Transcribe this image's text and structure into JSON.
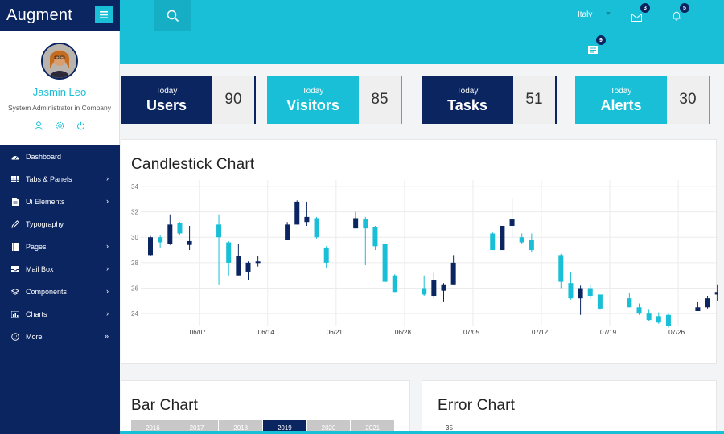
{
  "brand": {
    "title": "Augment"
  },
  "profile": {
    "name": "Jasmin Leo",
    "role": "System Administrator in Company"
  },
  "nav": {
    "items": [
      {
        "label": "Dashboard",
        "icon": "dashboard-icon",
        "has_arrow": false
      },
      {
        "label": "Tabs & Panels",
        "icon": "table-icon",
        "has_arrow": true
      },
      {
        "label": "Ui Elements",
        "icon": "file-icon",
        "has_arrow": true
      },
      {
        "label": "Typography",
        "icon": "pencil-icon",
        "has_arrow": false
      },
      {
        "label": "Pages",
        "icon": "book-icon",
        "has_arrow": true
      },
      {
        "label": "Mail Box",
        "icon": "inbox-icon",
        "has_arrow": true
      },
      {
        "label": "Components",
        "icon": "layers-icon",
        "has_arrow": true
      },
      {
        "label": "Charts",
        "icon": "chart-icon",
        "has_arrow": true
      },
      {
        "label": "More",
        "icon": "smile-icon",
        "has_arrow": true
      }
    ],
    "arrow": "›",
    "more_arrow": "»"
  },
  "topbar": {
    "language": "Italy",
    "mail_count": "3",
    "bell_count": "5",
    "messages_count": "9"
  },
  "stats": [
    {
      "small": "Today",
      "label": "Users",
      "value": "90",
      "theme": "navy"
    },
    {
      "small": "Today",
      "label": "Visitors",
      "value": "85",
      "theme": "cyan"
    },
    {
      "small": "Today",
      "label": "Tasks",
      "value": "51",
      "theme": "navy"
    },
    {
      "small": "Today",
      "label": "Alerts",
      "value": "30",
      "theme": "cyan"
    }
  ],
  "panels": {
    "candlestick_title": "Candlestick Chart",
    "bar_title": "Bar Chart",
    "error_title": "Error Chart",
    "error_first_tick": "35"
  },
  "colors": {
    "navy": "#0b2561",
    "cyan": "#18bfd6",
    "grey": "#c8c8c8"
  },
  "chart_data": {
    "type": "candlestick",
    "title": "Candlestick Chart",
    "yticks": [
      24,
      26,
      28,
      30,
      32,
      34
    ],
    "ylim": [
      23,
      34.5
    ],
    "xticks": [
      "06/07",
      "06/14",
      "06/21",
      "06/28",
      "07/05",
      "07/12",
      "07/19",
      "07/26"
    ],
    "candles": [
      {
        "day": 0,
        "open": 28.6,
        "close": 30.0,
        "high": 30.1,
        "low": 28.5,
        "dir": "up"
      },
      {
        "day": 1,
        "open": 30.0,
        "close": 29.6,
        "high": 30.2,
        "low": 29.2,
        "dir": "down"
      },
      {
        "day": 2,
        "open": 29.5,
        "close": 31.0,
        "high": 31.8,
        "low": 29.4,
        "dir": "up"
      },
      {
        "day": 3,
        "open": 31.1,
        "close": 30.3,
        "high": 31.2,
        "low": 30.2,
        "dir": "down"
      },
      {
        "day": 4,
        "open": 29.4,
        "close": 29.7,
        "high": 30.9,
        "low": 29.0,
        "dir": "up"
      },
      {
        "day": 7,
        "open": 31.0,
        "close": 30.0,
        "high": 31.8,
        "low": 26.3,
        "dir": "down"
      },
      {
        "day": 8,
        "open": 29.6,
        "close": 28.0,
        "high": 29.7,
        "low": 27.0,
        "dir": "down"
      },
      {
        "day": 9,
        "open": 27.0,
        "close": 28.5,
        "high": 29.5,
        "low": 27.0,
        "dir": "up"
      },
      {
        "day": 10,
        "open": 27.3,
        "close": 28.0,
        "high": 28.1,
        "low": 26.6,
        "dir": "up"
      },
      {
        "day": 11,
        "open": 28.1,
        "close": 28.0,
        "high": 28.5,
        "low": 27.7,
        "dir": "up"
      },
      {
        "day": 14,
        "open": 29.8,
        "close": 31.0,
        "high": 31.2,
        "low": 29.8,
        "dir": "up"
      },
      {
        "day": 15,
        "open": 31.0,
        "close": 32.8,
        "high": 32.9,
        "low": 31.0,
        "dir": "up"
      },
      {
        "day": 16,
        "open": 31.2,
        "close": 31.6,
        "high": 32.8,
        "low": 30.9,
        "dir": "up"
      },
      {
        "day": 17,
        "open": 31.5,
        "close": 30.0,
        "high": 31.6,
        "low": 29.9,
        "dir": "down"
      },
      {
        "day": 18,
        "open": 29.2,
        "close": 28.0,
        "high": 29.3,
        "low": 27.6,
        "dir": "down"
      },
      {
        "day": 21,
        "open": 30.7,
        "close": 31.5,
        "high": 32.0,
        "low": 30.7,
        "dir": "up"
      },
      {
        "day": 22,
        "open": 31.4,
        "close": 30.7,
        "high": 31.6,
        "low": 27.8,
        "dir": "down"
      },
      {
        "day": 23,
        "open": 30.8,
        "close": 29.3,
        "high": 30.9,
        "low": 29.0,
        "dir": "down"
      },
      {
        "day": 24,
        "open": 29.5,
        "close": 26.5,
        "high": 29.6,
        "low": 26.4,
        "dir": "down"
      },
      {
        "day": 25,
        "open": 27.0,
        "close": 25.7,
        "high": 27.1,
        "low": 25.7,
        "dir": "down"
      },
      {
        "day": 28,
        "open": 25.5,
        "close": 26.0,
        "high": 27.0,
        "low": 25.4,
        "dir": "down"
      },
      {
        "day": 29,
        "open": 25.4,
        "close": 26.6,
        "high": 27.2,
        "low": 25.2,
        "dir": "up"
      },
      {
        "day": 30,
        "open": 25.8,
        "close": 26.3,
        "high": 26.4,
        "low": 24.9,
        "dir": "up"
      },
      {
        "day": 31,
        "open": 26.3,
        "close": 28.0,
        "high": 28.6,
        "low": 26.3,
        "dir": "up"
      },
      {
        "day": 35,
        "open": 30.3,
        "close": 29.0,
        "high": 30.4,
        "low": 29.0,
        "dir": "down"
      },
      {
        "day": 36,
        "open": 29.0,
        "close": 30.9,
        "high": 30.9,
        "low": 29.0,
        "dir": "up"
      },
      {
        "day": 37,
        "open": 30.9,
        "close": 31.4,
        "high": 33.1,
        "low": 30.0,
        "dir": "up"
      },
      {
        "day": 38,
        "open": 30.0,
        "close": 29.6,
        "high": 30.3,
        "low": 29.5,
        "dir": "down"
      },
      {
        "day": 39,
        "open": 29.8,
        "close": 29.0,
        "high": 30.3,
        "low": 28.8,
        "dir": "down"
      },
      {
        "day": 42,
        "open": 28.6,
        "close": 26.5,
        "high": 28.7,
        "low": 26.0,
        "dir": "down"
      },
      {
        "day": 43,
        "open": 26.4,
        "close": 25.2,
        "high": 27.3,
        "low": 25.1,
        "dir": "down"
      },
      {
        "day": 44,
        "open": 25.2,
        "close": 26.0,
        "high": 26.2,
        "low": 23.9,
        "dir": "up"
      },
      {
        "day": 45,
        "open": 26.0,
        "close": 25.4,
        "high": 26.3,
        "low": 25.2,
        "dir": "down"
      },
      {
        "day": 46,
        "open": 25.5,
        "close": 24.4,
        "high": 25.5,
        "low": 24.3,
        "dir": "down"
      },
      {
        "day": 49,
        "open": 25.2,
        "close": 24.5,
        "high": 25.6,
        "low": 24.5,
        "dir": "down"
      },
      {
        "day": 50,
        "open": 24.5,
        "close": 24.0,
        "high": 24.8,
        "low": 23.9,
        "dir": "down"
      },
      {
        "day": 51,
        "open": 24.0,
        "close": 23.5,
        "high": 24.3,
        "low": 23.4,
        "dir": "down"
      },
      {
        "day": 52,
        "open": 23.8,
        "close": 23.3,
        "high": 24.1,
        "low": 23.2,
        "dir": "down"
      },
      {
        "day": 53,
        "open": 23.9,
        "close": 23.0,
        "high": 24.0,
        "low": 22.9,
        "dir": "down"
      },
      {
        "day": 56,
        "open": 24.2,
        "close": 24.5,
        "high": 24.9,
        "low": 24.2,
        "dir": "up"
      },
      {
        "day": 57,
        "open": 24.5,
        "close": 25.2,
        "high": 25.4,
        "low": 24.4,
        "dir": "up"
      },
      {
        "day": 58,
        "open": 25.5,
        "close": 25.7,
        "high": 26.3,
        "low": 25.0,
        "dir": "up"
      },
      {
        "day": 59,
        "open": 25.6,
        "close": 24.8,
        "high": 25.8,
        "low": 24.5,
        "dir": "down"
      }
    ]
  },
  "bar_tabs": [
    "2016",
    "2017",
    "2018",
    "2019",
    "2020",
    "2021"
  ],
  "bar_active": 3
}
